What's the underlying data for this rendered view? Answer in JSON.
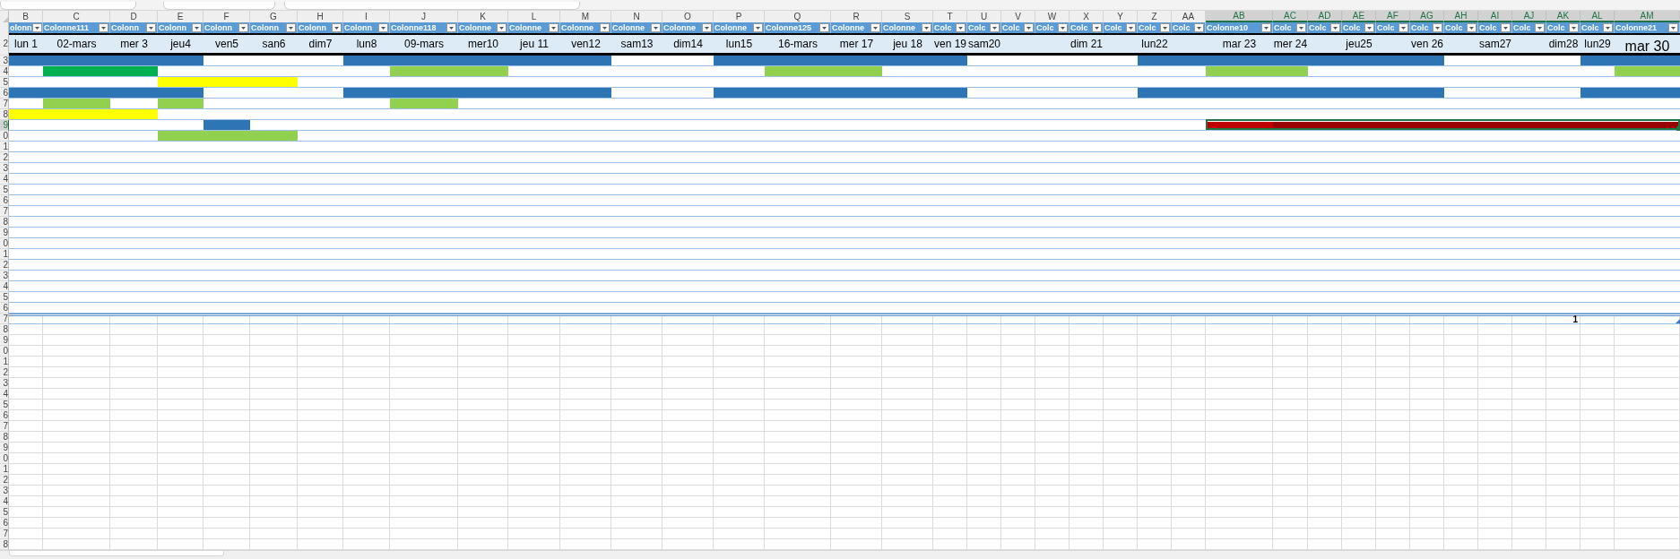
{
  "columns": [
    {
      "letter": "B",
      "name": "olonn",
      "date": "lun 1",
      "selected": false
    },
    {
      "letter": "C",
      "name": "Colonne111",
      "date": "02-mars",
      "selected": false
    },
    {
      "letter": "D",
      "name": "Colonn",
      "date": "mer 3",
      "selected": false
    },
    {
      "letter": "E",
      "name": "Colonn",
      "date": "jeu4",
      "selected": false
    },
    {
      "letter": "F",
      "name": "Colonn",
      "date": "ven5",
      "selected": false
    },
    {
      "letter": "G",
      "name": "Colonn",
      "date": "san6",
      "selected": false
    },
    {
      "letter": "H",
      "name": "Colonn",
      "date": "dim7",
      "selected": false
    },
    {
      "letter": "I",
      "name": "Colonn",
      "date": "lun8",
      "selected": false
    },
    {
      "letter": "J",
      "name": "Colonne118",
      "date": "09-mars",
      "selected": false
    },
    {
      "letter": "K",
      "name": "Colonne",
      "date": "mer10",
      "selected": false
    },
    {
      "letter": "L",
      "name": "Colonne",
      "date": "jeu 11",
      "selected": false
    },
    {
      "letter": "M",
      "name": "Colonne",
      "date": "ven12",
      "selected": false
    },
    {
      "letter": "N",
      "name": "Colonne",
      "date": "sam13",
      "selected": false
    },
    {
      "letter": "O",
      "name": "Colonne",
      "date": "dim14",
      "selected": false
    },
    {
      "letter": "P",
      "name": "Colonne",
      "date": "lun15",
      "selected": false
    },
    {
      "letter": "Q",
      "name": "Colonne125",
      "date": "16-mars",
      "selected": false
    },
    {
      "letter": "R",
      "name": "Colonne",
      "date": "mer 17",
      "selected": false
    },
    {
      "letter": "S",
      "name": "Colonne",
      "date": "jeu 18",
      "selected": false
    },
    {
      "letter": "T",
      "name": "Colc",
      "date": "ven 19",
      "selected": false
    },
    {
      "letter": "U",
      "name": "Colc",
      "date": "sam20",
      "selected": false
    },
    {
      "letter": "V",
      "name": "Colc",
      "selected": false
    },
    {
      "letter": "W",
      "name": "Colc",
      "selected": false
    },
    {
      "letter": "X",
      "name": "Colc",
      "date": "dim 21",
      "selected": false
    },
    {
      "letter": "Y",
      "name": "Colc",
      "selected": false
    },
    {
      "letter": "Z",
      "name": "Colc",
      "date": "lun22",
      "selected": false
    },
    {
      "letter": "AA",
      "name": "Colc",
      "selected": false
    },
    {
      "letter": "AB",
      "name": "Colonne10",
      "date": "mar 23",
      "selected": true
    },
    {
      "letter": "AC",
      "name": "Colc",
      "date": "mer 24",
      "selected": true
    },
    {
      "letter": "AD",
      "name": "Colc",
      "selected": true
    },
    {
      "letter": "AE",
      "name": "Colc",
      "date": "jeu25",
      "selected": true
    },
    {
      "letter": "AF",
      "name": "Colc",
      "selected": true
    },
    {
      "letter": "AG",
      "name": "Colc",
      "date": "ven 26",
      "selected": true
    },
    {
      "letter": "AH",
      "name": "Colc",
      "selected": true
    },
    {
      "letter": "AI",
      "name": "Colc",
      "date": "sam27",
      "selected": true
    },
    {
      "letter": "AJ",
      "name": "Colc",
      "selected": true
    },
    {
      "letter": "AK",
      "name": "Colc",
      "date": "dim28",
      "selected": true,
      "total": "1"
    },
    {
      "letter": "AL",
      "name": "Colc",
      "date": "lun29",
      "selected": true
    },
    {
      "letter": "AM",
      "name": "Colonne21",
      "date": "mar 30",
      "selected": true,
      "large": true
    }
  ],
  "date_row_number": "2",
  "rows": [
    {
      "number": "3",
      "selected": false,
      "cells": [
        {
          "color": "#2e75b6"
        },
        {
          "color": "#2e75b6"
        },
        {
          "color": "#2e75b6"
        },
        {
          "color": "#2e75b6"
        },
        {
          "color": "#ffffff"
        },
        {
          "color": "#ffffff"
        },
        {
          "color": "#ffffff"
        },
        {
          "color": "#2e75b6"
        },
        {
          "color": "#2e75b6"
        },
        {
          "color": "#2e75b6"
        },
        {
          "color": "#2e75b6"
        },
        {
          "color": "#2e75b6"
        },
        {
          "color": "#ffffff"
        },
        {
          "color": "#ffffff"
        },
        {
          "color": "#2e75b6"
        },
        {
          "color": "#2e75b6"
        },
        {
          "color": "#2e75b6"
        },
        {
          "color": "#2e75b6"
        },
        {
          "color": "#2e75b6"
        },
        {
          "color": "#ffffff"
        },
        {
          "color": "#ffffff"
        },
        {
          "color": "#ffffff"
        },
        {
          "color": "#ffffff"
        },
        {
          "color": "#ffffff"
        },
        {
          "color": "#2e75b6"
        },
        {
          "color": "#2e75b6"
        },
        {
          "color": "#2e75b6"
        },
        {
          "color": "#2e75b6"
        },
        {
          "color": "#2e75b6"
        },
        {
          "color": "#2e75b6"
        },
        {
          "color": "#2e75b6"
        },
        {
          "color": "#2e75b6"
        },
        {
          "color": "#ffffff"
        },
        {
          "color": "#ffffff"
        },
        {
          "color": "#ffffff"
        },
        {
          "color": "#ffffff"
        },
        {
          "color": "#2e75b6"
        },
        {
          "color": "#2e75b6"
        }
      ]
    },
    {
      "number": "4",
      "selected": false,
      "cells": [
        {
          "color": "#ffffff"
        },
        {
          "color": "#00b050"
        },
        {
          "color": "#00b050"
        },
        {
          "color": "#ffffff"
        },
        {
          "color": "#ffffff"
        },
        {
          "color": "#ffffff"
        },
        {
          "color": "#ffffff"
        },
        {
          "color": "#ffffff"
        },
        {
          "color": "#92d050"
        },
        {
          "color": "#92d050"
        },
        {
          "color": "#ffffff"
        },
        {
          "color": "#ffffff"
        },
        {
          "color": "#ffffff"
        },
        {
          "color": "#ffffff"
        },
        {
          "color": "#ffffff"
        },
        {
          "color": "#92d050"
        },
        {
          "color": "#92d050"
        },
        {
          "color": "#ffffff"
        },
        {
          "color": "#ffffff"
        },
        {
          "color": "#ffffff"
        },
        {
          "color": "#ffffff"
        },
        {
          "color": "#ffffff"
        },
        {
          "color": "#ffffff"
        },
        {
          "color": "#ffffff"
        },
        {
          "color": "#ffffff"
        },
        {
          "color": "#ffffff"
        },
        {
          "color": "#92d050"
        },
        {
          "color": "#92d050"
        },
        {
          "color": "#ffffff"
        },
        {
          "color": "#ffffff"
        },
        {
          "color": "#ffffff"
        },
        {
          "color": "#ffffff"
        },
        {
          "color": "#ffffff"
        },
        {
          "color": "#ffffff"
        },
        {
          "color": "#ffffff"
        },
        {
          "color": "#ffffff"
        },
        {
          "color": "#ffffff"
        },
        {
          "color": "#92d050"
        }
      ]
    },
    {
      "number": "5",
      "selected": false,
      "cells": [
        {
          "color": "#ffffff"
        },
        {
          "color": "#ffffff"
        },
        {
          "color": "#ffffff"
        },
        {
          "color": "#ffff00"
        },
        {
          "color": "#ffff00"
        },
        {
          "color": "#ffff00"
        },
        {
          "color": "#ffffff"
        },
        {
          "color": "#ffffff"
        },
        {
          "color": "#ffffff"
        },
        {
          "color": "#ffffff"
        },
        {
          "color": "#ffffff"
        },
        {
          "color": "#ffffff"
        },
        {
          "color": "#ffffff"
        },
        {
          "color": "#ffffff"
        },
        {
          "color": "#ffffff"
        },
        {
          "color": "#ffffff"
        },
        {
          "color": "#ffffff"
        },
        {
          "color": "#ffffff"
        },
        {
          "color": "#ffffff"
        },
        {
          "color": "#ffffff"
        },
        {
          "color": "#ffffff"
        },
        {
          "color": "#ffffff"
        },
        {
          "color": "#ffffff"
        },
        {
          "color": "#ffffff"
        },
        {
          "color": "#ffffff"
        },
        {
          "color": "#ffffff"
        },
        {
          "color": "#ffffff"
        },
        {
          "color": "#ffffff"
        },
        {
          "color": "#ffffff"
        },
        {
          "color": "#ffffff"
        },
        {
          "color": "#ffffff"
        },
        {
          "color": "#ffffff"
        },
        {
          "color": "#ffffff"
        },
        {
          "color": "#ffffff"
        },
        {
          "color": "#ffffff"
        },
        {
          "color": "#ffffff"
        },
        {
          "color": "#ffffff"
        },
        {
          "color": "#ffffff"
        }
      ]
    },
    {
      "number": "6",
      "selected": false,
      "cells": [
        {
          "color": "#2e75b6"
        },
        {
          "color": "#2e75b6"
        },
        {
          "color": "#2e75b6"
        },
        {
          "color": "#2e75b6"
        },
        {
          "color": "#ffffff"
        },
        {
          "color": "#ffffff"
        },
        {
          "color": "#ffffff"
        },
        {
          "color": "#2e75b6"
        },
        {
          "color": "#2e75b6"
        },
        {
          "color": "#2e75b6"
        },
        {
          "color": "#2e75b6"
        },
        {
          "color": "#2e75b6"
        },
        {
          "color": "#ffffff"
        },
        {
          "color": "#ffffff"
        },
        {
          "color": "#2e75b6"
        },
        {
          "color": "#2e75b6"
        },
        {
          "color": "#2e75b6"
        },
        {
          "color": "#2e75b6"
        },
        {
          "color": "#2e75b6"
        },
        {
          "color": "#ffffff"
        },
        {
          "color": "#ffffff"
        },
        {
          "color": "#ffffff"
        },
        {
          "color": "#ffffff"
        },
        {
          "color": "#ffffff"
        },
        {
          "color": "#2e75b6"
        },
        {
          "color": "#2e75b6"
        },
        {
          "color": "#2e75b6"
        },
        {
          "color": "#2e75b6"
        },
        {
          "color": "#2e75b6"
        },
        {
          "color": "#2e75b6"
        },
        {
          "color": "#2e75b6"
        },
        {
          "color": "#2e75b6"
        },
        {
          "color": "#ffffff"
        },
        {
          "color": "#ffffff"
        },
        {
          "color": "#ffffff"
        },
        {
          "color": "#ffffff"
        },
        {
          "color": "#2e75b6"
        },
        {
          "color": "#2e75b6"
        }
      ]
    },
    {
      "number": "7",
      "selected": false,
      "cells": [
        {
          "color": "#ffffff"
        },
        {
          "color": "#92d050"
        },
        {
          "color": "#ffffff"
        },
        {
          "color": "#92d050"
        },
        {
          "color": "#ffffff"
        },
        {
          "color": "#ffffff"
        },
        {
          "color": "#ffffff"
        },
        {
          "color": "#ffffff"
        },
        {
          "color": "#92d050"
        },
        {
          "color": "#ffffff"
        },
        {
          "color": "#ffffff"
        },
        {
          "color": "#ffffff"
        },
        {
          "color": "#ffffff"
        },
        {
          "color": "#ffffff"
        },
        {
          "color": "#ffffff"
        },
        {
          "color": "#ffffff"
        },
        {
          "color": "#ffffff"
        },
        {
          "color": "#ffffff"
        },
        {
          "color": "#ffffff"
        },
        {
          "color": "#ffffff"
        },
        {
          "color": "#ffffff"
        },
        {
          "color": "#ffffff"
        },
        {
          "color": "#ffffff"
        },
        {
          "color": "#ffffff"
        },
        {
          "color": "#ffffff"
        },
        {
          "color": "#ffffff"
        },
        {
          "color": "#ffffff"
        },
        {
          "color": "#ffffff"
        },
        {
          "color": "#ffffff"
        },
        {
          "color": "#ffffff"
        },
        {
          "color": "#ffffff"
        },
        {
          "color": "#ffffff"
        },
        {
          "color": "#ffffff"
        },
        {
          "color": "#ffffff"
        },
        {
          "color": "#ffffff"
        },
        {
          "color": "#ffffff"
        },
        {
          "color": "#ffffff"
        },
        {
          "color": "#ffffff"
        }
      ]
    },
    {
      "number": "8",
      "selected": false,
      "cells": [
        {
          "color": "#ffff00"
        },
        {
          "color": "#ffff00"
        },
        {
          "color": "#ffff00"
        },
        {
          "color": "#ffffff"
        },
        {
          "color": "#ffffff"
        },
        {
          "color": "#ffffff"
        },
        {
          "color": "#ffffff"
        },
        {
          "color": "#ffffff"
        },
        {
          "color": "#ffffff"
        },
        {
          "color": "#ffffff"
        },
        {
          "color": "#ffffff"
        },
        {
          "color": "#ffffff"
        },
        {
          "color": "#ffffff"
        },
        {
          "color": "#ffffff"
        },
        {
          "color": "#ffffff"
        },
        {
          "color": "#ffffff"
        },
        {
          "color": "#ffffff"
        },
        {
          "color": "#ffffff"
        },
        {
          "color": "#ffffff"
        },
        {
          "color": "#ffffff"
        },
        {
          "color": "#ffffff"
        },
        {
          "color": "#ffffff"
        },
        {
          "color": "#ffffff"
        },
        {
          "color": "#ffffff"
        },
        {
          "color": "#ffffff"
        },
        {
          "color": "#ffffff"
        },
        {
          "color": "#ffffff"
        },
        {
          "color": "#ffffff"
        },
        {
          "color": "#ffffff"
        },
        {
          "color": "#ffffff"
        },
        {
          "color": "#ffffff"
        },
        {
          "color": "#ffffff"
        },
        {
          "color": "#ffffff"
        },
        {
          "color": "#ffffff"
        },
        {
          "color": "#ffffff"
        },
        {
          "color": "#ffffff"
        },
        {
          "color": "#ffffff"
        },
        {
          "color": "#ffffff"
        }
      ]
    },
    {
      "number": "9",
      "selected": true,
      "cells": [
        {
          "color": "#ffffff"
        },
        {
          "color": "#ffffff"
        },
        {
          "color": "#ffffff"
        },
        {
          "color": "#ffffff"
        },
        {
          "color": "#2e75b6"
        },
        {
          "color": "#ffffff"
        },
        {
          "color": "#ffffff"
        },
        {
          "color": "#ffffff"
        },
        {
          "color": "#ffffff"
        },
        {
          "color": "#ffffff"
        },
        {
          "color": "#ffffff"
        },
        {
          "color": "#ffffff"
        },
        {
          "color": "#ffffff"
        },
        {
          "color": "#ffffff"
        },
        {
          "color": "#ffffff"
        },
        {
          "color": "#ffffff"
        },
        {
          "color": "#ffffff"
        },
        {
          "color": "#ffffff"
        },
        {
          "color": "#ffffff"
        },
        {
          "color": "#ffffff"
        },
        {
          "color": "#ffffff"
        },
        {
          "color": "#ffffff"
        },
        {
          "color": "#ffffff"
        },
        {
          "color": "#ffffff"
        },
        {
          "color": "#ffffff"
        },
        {
          "color": "#ffffff"
        },
        {
          "color": "#c00000"
        },
        {
          "color": "#990000"
        },
        {
          "color": "#990000"
        },
        {
          "color": "#990000"
        },
        {
          "color": "#990000"
        },
        {
          "color": "#990000"
        },
        {
          "color": "#990000"
        },
        {
          "color": "#990000"
        },
        {
          "color": "#990000"
        },
        {
          "color": "#990000"
        },
        {
          "color": "#990000"
        },
        {
          "color": "#990000"
        }
      ]
    },
    {
      "number": "0",
      "selected": false,
      "cells": [
        {
          "color": "#ffffff"
        },
        {
          "color": "#ffffff"
        },
        {
          "color": "#ffffff"
        },
        {
          "color": "#92d050"
        },
        {
          "color": "#92d050"
        },
        {
          "color": "#92d050"
        },
        {
          "color": "#ffffff"
        },
        {
          "color": "#ffffff"
        },
        {
          "color": "#ffffff"
        },
        {
          "color": "#ffffff"
        },
        {
          "color": "#ffffff"
        },
        {
          "color": "#ffffff"
        },
        {
          "color": "#ffffff"
        },
        {
          "color": "#ffffff"
        },
        {
          "color": "#ffffff"
        },
        {
          "color": "#ffffff"
        },
        {
          "color": "#ffffff"
        },
        {
          "color": "#ffffff"
        },
        {
          "color": "#ffffff"
        },
        {
          "color": "#ffffff"
        },
        {
          "color": "#ffffff"
        },
        {
          "color": "#ffffff"
        },
        {
          "color": "#ffffff"
        },
        {
          "color": "#ffffff"
        },
        {
          "color": "#ffffff"
        },
        {
          "color": "#ffffff"
        },
        {
          "color": "#ffffff"
        },
        {
          "color": "#ffffff"
        },
        {
          "color": "#ffffff"
        },
        {
          "color": "#ffffff"
        },
        {
          "color": "#ffffff"
        },
        {
          "color": "#ffffff"
        },
        {
          "color": "#ffffff"
        },
        {
          "color": "#ffffff"
        },
        {
          "color": "#ffffff"
        },
        {
          "color": "#ffffff"
        },
        {
          "color": "#ffffff"
        },
        {
          "color": "#ffffff"
        }
      ]
    },
    {
      "number": "1",
      "selected": false
    },
    {
      "number": "2",
      "selected": false
    },
    {
      "number": "3",
      "selected": false
    },
    {
      "number": "4",
      "selected": false
    },
    {
      "number": "5",
      "selected": false
    },
    {
      "number": "6",
      "selected": false
    },
    {
      "number": "7",
      "selected": false
    },
    {
      "number": "8",
      "selected": false
    },
    {
      "number": "9",
      "selected": false
    },
    {
      "number": "0",
      "selected": false
    },
    {
      "number": "1",
      "selected": false
    },
    {
      "number": "2",
      "selected": false
    },
    {
      "number": "3",
      "selected": false
    },
    {
      "number": "4",
      "selected": false
    },
    {
      "number": "5",
      "selected": false
    },
    {
      "number": "6",
      "selected": false
    }
  ],
  "total_row_number": "7",
  "grid_rows": [
    "8",
    "9",
    "0",
    "1",
    "2",
    "3",
    "4",
    "5",
    "6",
    "7",
    "8",
    "9",
    "0",
    "1",
    "2",
    "3",
    "4",
    "5",
    "6",
    "7",
    "8"
  ]
}
